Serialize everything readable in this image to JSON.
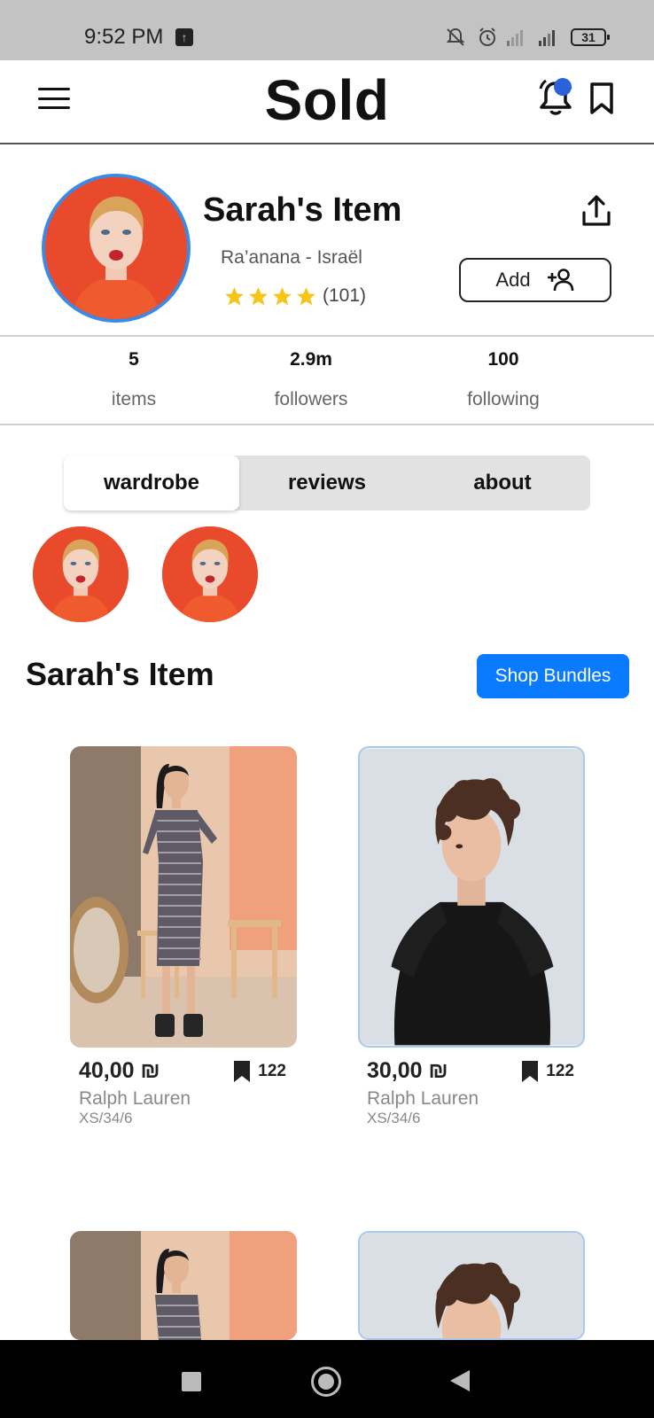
{
  "status_bar": {
    "time": "9:52 PM",
    "battery": "31",
    "icons": [
      "upload-icon",
      "mute-icon",
      "alarm-icon",
      "signal-icon",
      "signal-icon",
      "battery-icon"
    ]
  },
  "app_bar": {
    "title": "Sold",
    "icons": [
      "menu-icon",
      "bell-icon",
      "bookmark-icon"
    ],
    "notification_dot_color": "#2b62d8"
  },
  "profile": {
    "name": "Sarah's Item",
    "location": "Ra’anana - Israël",
    "stars": 4,
    "rating_count": "(101)",
    "add_button": "Add",
    "star_color": "#f5c518",
    "avatar_ring_color": "#3a8ae6"
  },
  "stats": [
    {
      "value": "5",
      "label": "items"
    },
    {
      "value": "2.9m",
      "label": "followers"
    },
    {
      "value": "100",
      "label": "following"
    }
  ],
  "tabs": [
    {
      "label": "wardrobe",
      "active": true
    },
    {
      "label": "reviews",
      "active": false
    },
    {
      "label": "about",
      "active": false
    }
  ],
  "section": {
    "title": "Sarah's Item",
    "shop_button": "Shop Bundles",
    "shop_button_color": "#0a7bff"
  },
  "products": [
    {
      "price": "40,00 ₪",
      "saves": "122",
      "brand": "Ralph Lauren",
      "size": "XS/34/6"
    },
    {
      "price": "30,00 ₪",
      "saves": "122",
      "brand": "Ralph Lauren",
      "size": "XS/34/6"
    }
  ]
}
